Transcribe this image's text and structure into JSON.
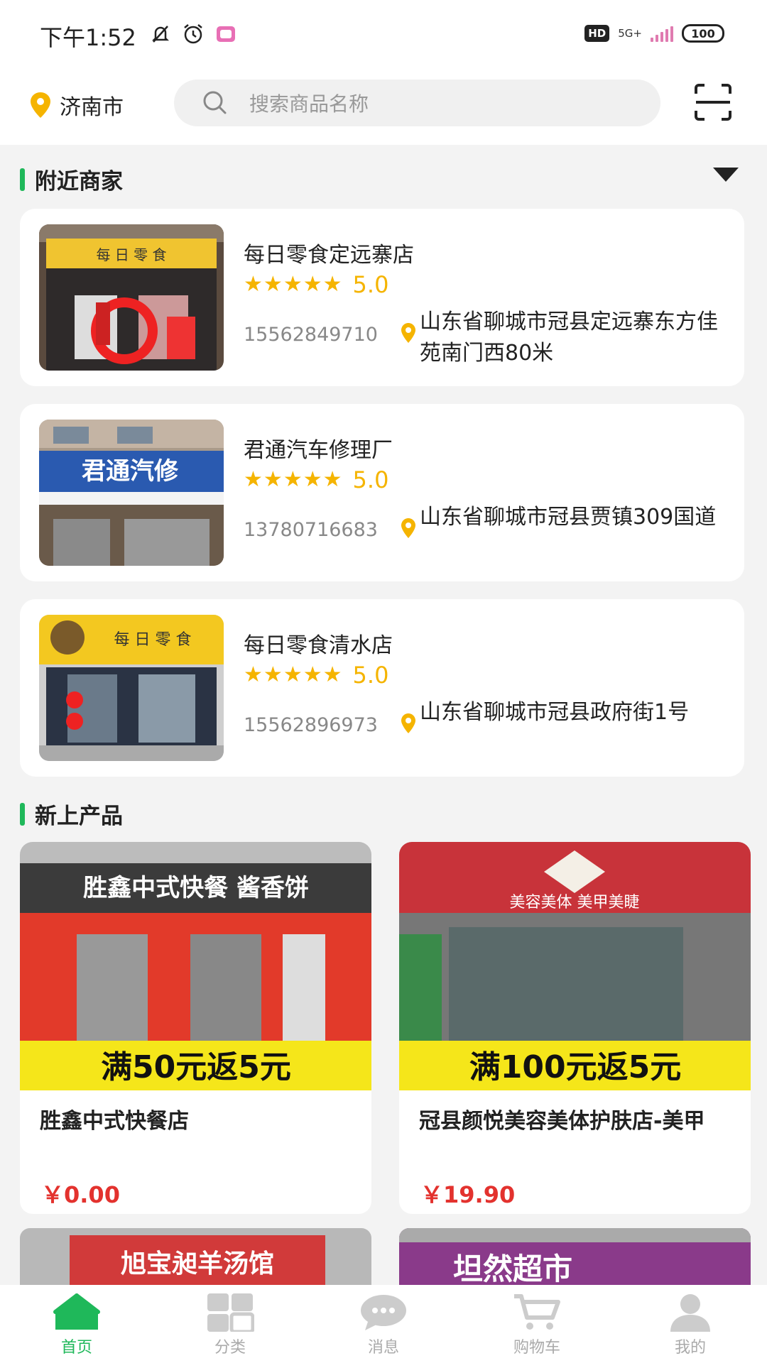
{
  "status_bar": {
    "time": "下午1:52",
    "hd": "HD",
    "network": "5G+",
    "battery": "100"
  },
  "header": {
    "city": "济南市",
    "search_placeholder": "搜索商品名称"
  },
  "sections": {
    "nearby": "附近商家",
    "new_products": "新上产品"
  },
  "stores": [
    {
      "name": "每日零食定远寨店",
      "rating": "5.0",
      "phone": "15562849710",
      "address": "山东省聊城市冠县定远寨东方佳苑南门西80米"
    },
    {
      "name": "君通汽车修理厂",
      "rating": "5.0",
      "phone": "13780716683",
      "address": "山东省聊城市冠县贾镇309国道"
    },
    {
      "name": "每日零食清水店",
      "rating": "5.0",
      "phone": "15562896973",
      "address": "山东省聊城市冠县政府街1号"
    }
  ],
  "store_images": {
    "s1_sign": "每 日 零 食",
    "s2_sign": "君通汽修",
    "s3_sign": "每 日 零 食"
  },
  "products": [
    {
      "name": "胜鑫中式快餐店",
      "price": "￥0.00",
      "sign": "胜鑫中式快餐 酱香饼",
      "promo": "满50元返5元"
    },
    {
      "name": "冠县颜悦美容美体护肤店-美甲",
      "price": "￥19.90",
      "sign": "美容美体 美甲美睫",
      "promo": "满100元返5元"
    }
  ],
  "peek": [
    {
      "sign": "旭宝昶羊汤馆"
    },
    {
      "sign": "坦然超市"
    }
  ],
  "tabs": [
    {
      "label": "首页",
      "icon": "home-icon",
      "active": true
    },
    {
      "label": "分类",
      "icon": "category-icon",
      "active": false
    },
    {
      "label": "消息",
      "icon": "message-icon",
      "active": false
    },
    {
      "label": "购物车",
      "icon": "cart-icon",
      "active": false
    },
    {
      "label": "我的",
      "icon": "profile-icon",
      "active": false
    }
  ],
  "colors": {
    "accent": "#1fb85a",
    "star": "#f5b400",
    "price": "#e3322e"
  }
}
